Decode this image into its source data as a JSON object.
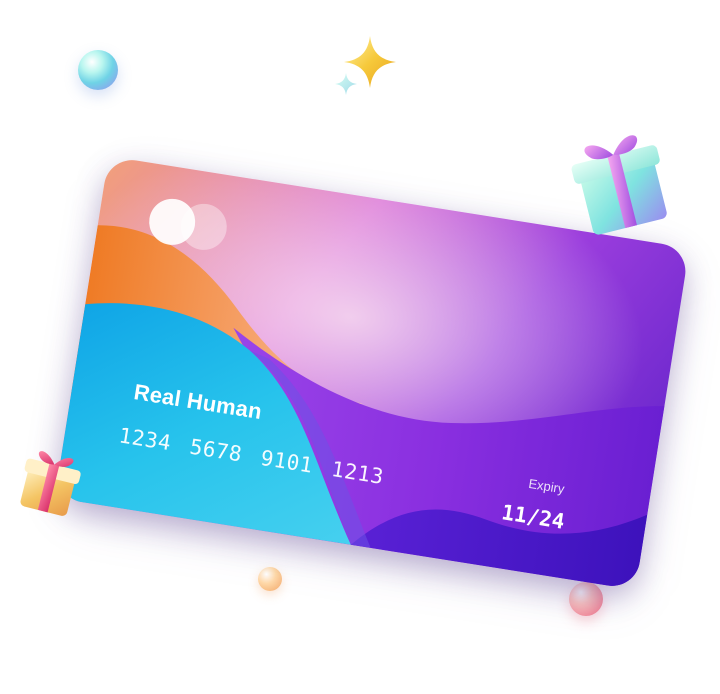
{
  "card": {
    "holder_name": "Real Human",
    "card_number": "1234 5678 9101 1213",
    "expiry_label": "Expiry",
    "expiry_value": "11/24"
  },
  "decorations": {
    "icons": [
      "sparkle-icon",
      "gift-icon",
      "orb"
    ],
    "colors": {
      "card_blue": "#1fb6ea",
      "card_orange": "#f3813a",
      "card_purple": "#8a2fe0",
      "card_deep_violet": "#4b16c4",
      "sparkle_gold": "#f6c93b",
      "gift_teal": "#7fe3e0",
      "gift_gold": "#f4c463"
    }
  }
}
